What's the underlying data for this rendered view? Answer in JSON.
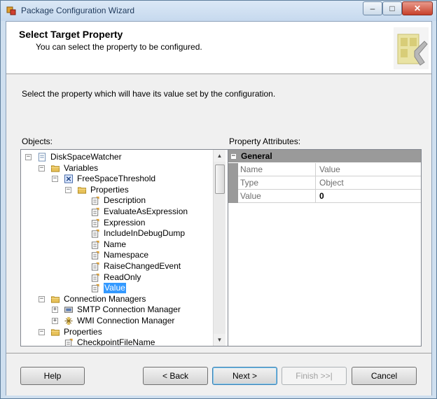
{
  "window": {
    "title": "Package Configuration Wizard",
    "min_glyph": "–",
    "max_glyph": "□",
    "close_glyph": "✕"
  },
  "header": {
    "title": "Select Target Property",
    "subtitle": "You can select the property to be configured."
  },
  "instructions": "Select the property which will have its value set by the configuration.",
  "objects_label": "Objects:",
  "attributes_label": "Property Attributes:",
  "tree": {
    "items": [
      {
        "label": "DiskSpaceWatcher",
        "icon": "package-icon",
        "expander": "−"
      },
      {
        "label": "Variables",
        "icon": "folder-icon",
        "expander": "−"
      },
      {
        "label": "FreeSpaceThreshold",
        "icon": "variable-icon",
        "expander": "−"
      },
      {
        "label": "Properties",
        "icon": "folder-icon",
        "expander": "−"
      },
      {
        "label": "Description",
        "icon": "property-icon"
      },
      {
        "label": "EvaluateAsExpression",
        "icon": "property-icon"
      },
      {
        "label": "Expression",
        "icon": "property-icon"
      },
      {
        "label": "IncludeInDebugDump",
        "icon": "property-icon"
      },
      {
        "label": "Name",
        "icon": "property-icon"
      },
      {
        "label": "Namespace",
        "icon": "property-icon"
      },
      {
        "label": "RaiseChangedEvent",
        "icon": "property-icon"
      },
      {
        "label": "ReadOnly",
        "icon": "property-icon"
      },
      {
        "label": "Value",
        "icon": "property-icon",
        "selected": true
      },
      {
        "label": "Connection Managers",
        "icon": "folder-icon",
        "expander": "−"
      },
      {
        "label": "SMTP Connection Manager",
        "icon": "smtp-connection-icon",
        "expander": "+"
      },
      {
        "label": "WMI Connection Manager",
        "icon": "wmi-connection-icon",
        "expander": "+"
      },
      {
        "label": "Properties",
        "icon": "folder-icon",
        "expander": "−"
      },
      {
        "label": "CheckpointFileName",
        "icon": "property-icon"
      }
    ],
    "scroll_up": "▲",
    "scroll_down": "▼"
  },
  "attributes": {
    "category": "General",
    "category_expander": "−",
    "rows": [
      {
        "name": "Name",
        "value": "Value",
        "bold": false
      },
      {
        "name": "Type",
        "value": "Object",
        "bold": false
      },
      {
        "name": "Value",
        "value": "0",
        "bold": true
      }
    ]
  },
  "buttons": {
    "help": "Help",
    "back": "< Back",
    "next": "Next >",
    "finish": "Finish >>|",
    "cancel": "Cancel"
  },
  "colors": {
    "selection": "#3399ff",
    "grid_category": "#9a9a9a",
    "folder": "#e8c25a"
  }
}
